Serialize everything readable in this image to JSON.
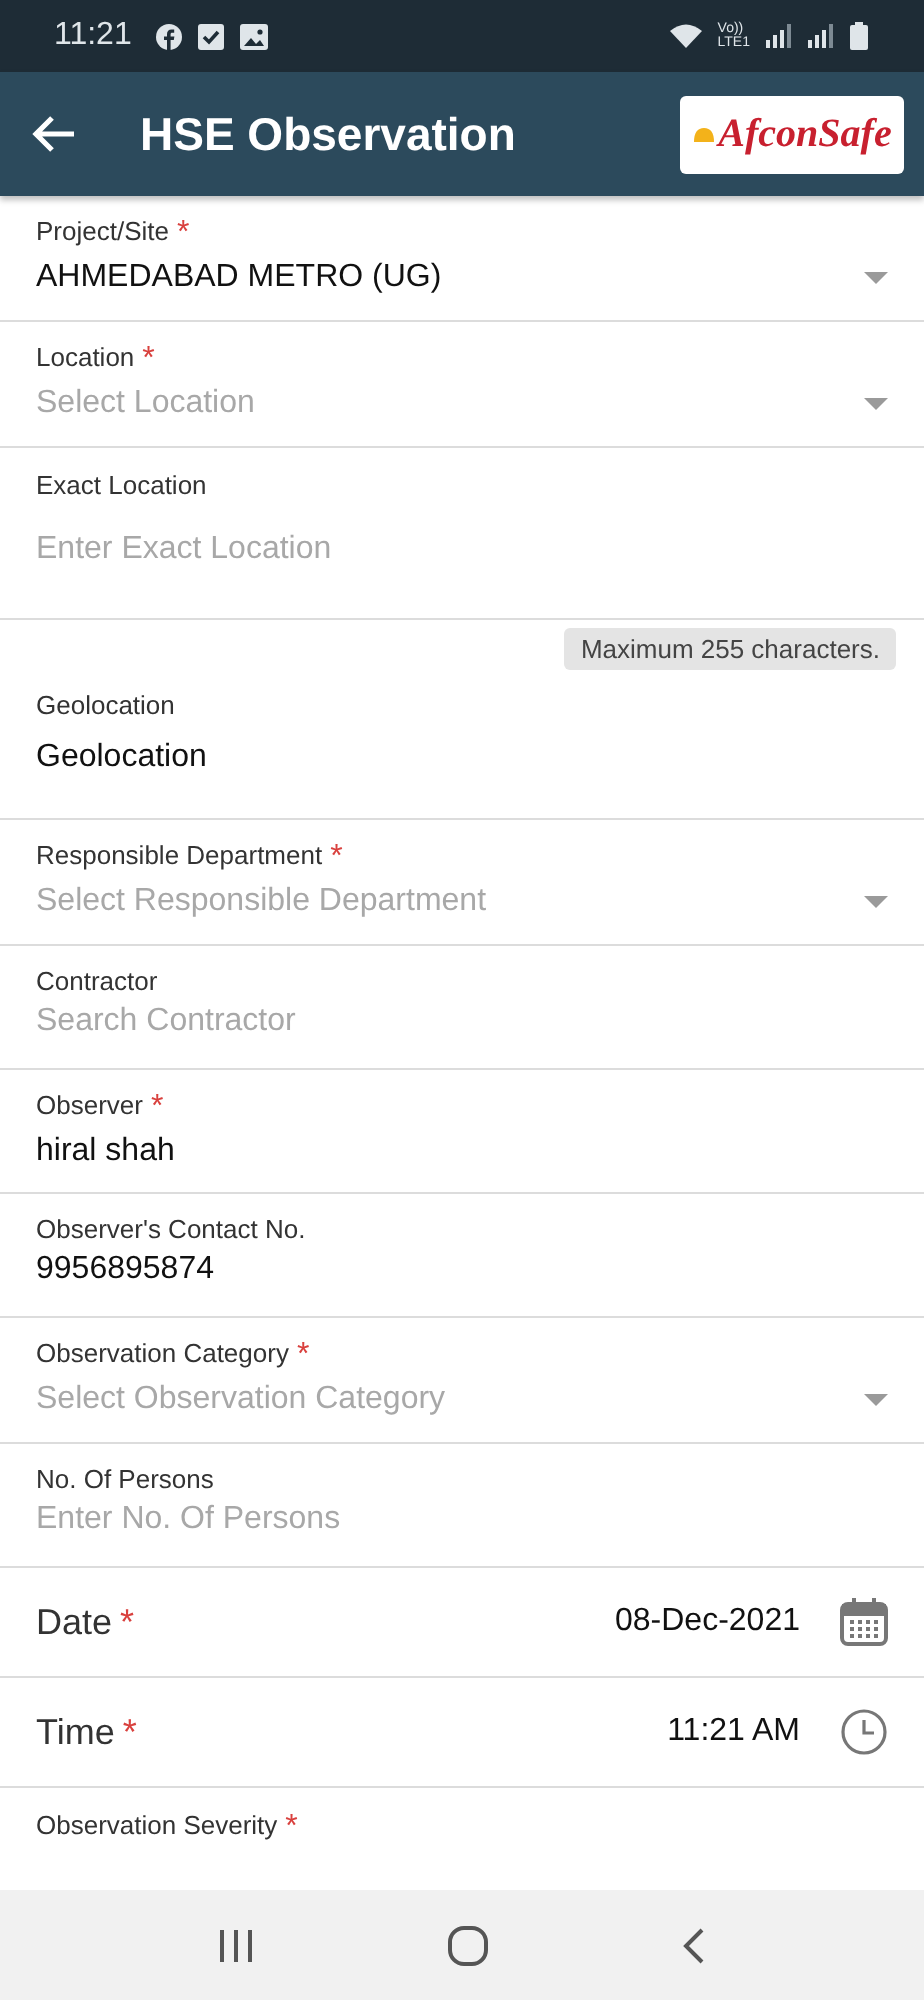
{
  "status_bar": {
    "time": "11:21",
    "network_top": "Vo))",
    "network_bottom": "LTE1"
  },
  "app_bar": {
    "title": "HSE Observation",
    "logo_text": "AfconSafe"
  },
  "required_mark": "*",
  "fields": [
    {
      "kind": "select",
      "label": "Project/Site",
      "required": true,
      "value": "AHMEDABAD METRO (UG)"
    },
    {
      "kind": "select",
      "label": "Location",
      "required": true,
      "placeholder": "Select Location"
    },
    {
      "kind": "input",
      "label": "Exact Location",
      "required": false,
      "placeholder": "Enter Exact Location",
      "hint": "Maximum 255 characters."
    },
    {
      "kind": "input",
      "label": "Geolocation",
      "required": false,
      "value": "Geolocation"
    },
    {
      "kind": "select",
      "label": "Responsible Department",
      "required": true,
      "placeholder": "Select Responsible Department"
    },
    {
      "kind": "input",
      "label": "Contractor",
      "required": false,
      "placeholder": "Search Contractor"
    },
    {
      "kind": "input",
      "label": "Observer",
      "required": true,
      "value": "hiral shah"
    },
    {
      "kind": "input",
      "label": "Observer's Contact No.",
      "required": false,
      "value": "9956895874"
    },
    {
      "kind": "select",
      "label": "Observation Category",
      "required": true,
      "placeholder": "Select Observation Category"
    },
    {
      "kind": "input",
      "label": "No. Of Persons",
      "required": false,
      "placeholder": "Enter No. Of Persons"
    },
    {
      "kind": "date",
      "label": "Date",
      "required": true,
      "value": "08-Dec-2021"
    },
    {
      "kind": "time",
      "label": "Time",
      "required": true,
      "value": "11:21 AM"
    },
    {
      "kind": "cut",
      "label": "Observation Severity",
      "required": true
    }
  ]
}
